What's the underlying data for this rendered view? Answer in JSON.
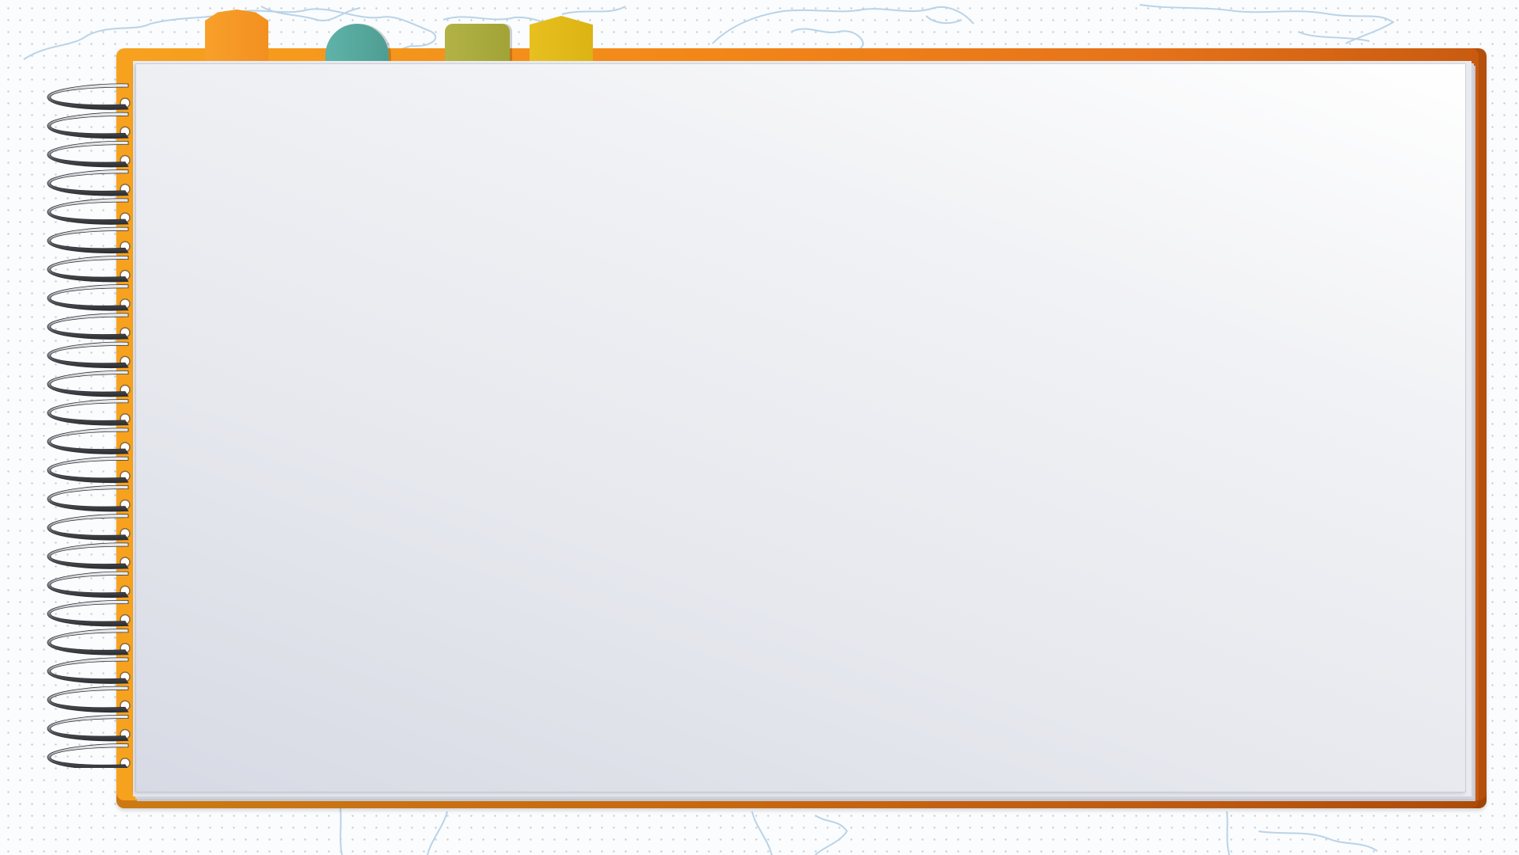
{
  "colors": {
    "cover_light": "#f7a21e",
    "cover_dark": "#c85a10",
    "page": "#ecedf2",
    "map_outline": "#b9d3e8",
    "tab_orange": "#f39020",
    "tab_teal": "#5fb3a8",
    "tab_olive": "#a8a93b",
    "tab_yellow": "#e2ba18",
    "spiral_metal": "#777a80"
  },
  "tabs": [
    {
      "name": "orange-tab"
    },
    {
      "name": "teal-tab"
    },
    {
      "name": "olive-tab"
    },
    {
      "name": "yellow-tab"
    }
  ],
  "spiral": {
    "rings": 24
  }
}
